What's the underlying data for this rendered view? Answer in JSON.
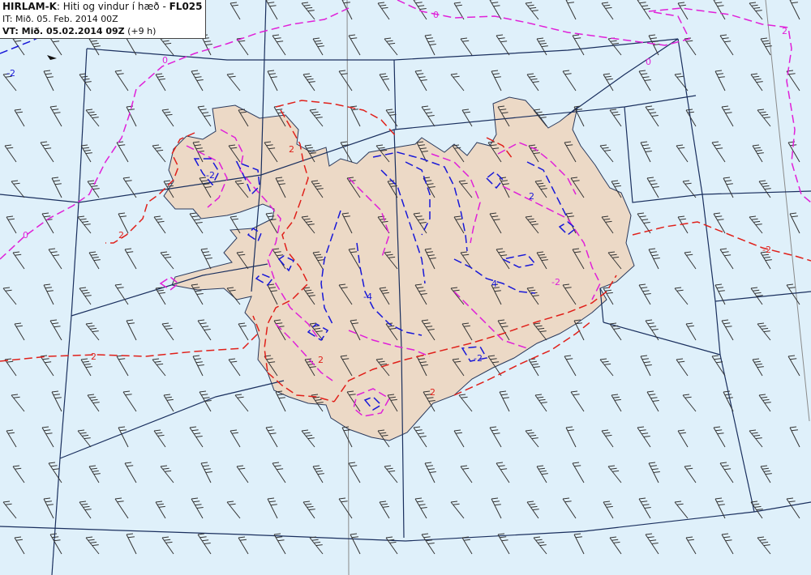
{
  "header": {
    "model": "HIRLAM-K",
    "sep1": ": ",
    "description": "Hiti og vindur í hæð",
    "sep2": " - ",
    "level": "FL025",
    "it_label": "IT: ",
    "it_value": "Mið. 05. Feb. 2014 00Z",
    "vt_label": "VT: ",
    "vt_value": "Mið. 05.02.2014 09Z",
    "vt_offset": " (+9 h)"
  },
  "map": {
    "contour_labels": [
      "-2",
      "0",
      "0",
      "0",
      "2",
      "2",
      "-2",
      "2",
      "-2",
      "2",
      "2",
      "4",
      "-4",
      "-2",
      "2",
      "-2",
      "0",
      "2"
    ],
    "colors": {
      "sea": "#dff0fa",
      "land": "#ecd9c6",
      "coast": "#2b3a5c",
      "grid": "#1a2f5e",
      "meridian": "#8a8a8a",
      "contour_red": "#e0201a",
      "contour_magenta": "#e020d8",
      "contour_blue": "#1818d8",
      "wind_barb": "#333333"
    },
    "icons": {
      "wind": "wind-barb-icon"
    }
  }
}
